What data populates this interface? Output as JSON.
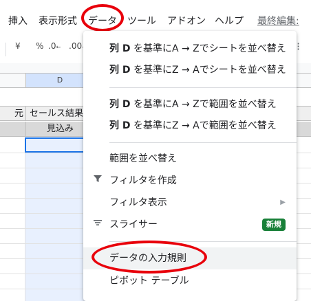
{
  "menubar": {
    "insert": "挿入",
    "format": "表示形式",
    "data": "データ",
    "tools": "ツール",
    "addons": "アドオン",
    "help": "ヘルプ",
    "last_edit": "最終編集:"
  },
  "toolbar": {
    "currency": "¥",
    "percent": "%",
    "decrease_decimal": ".0",
    "increase_decimal": ".00",
    "more": "⁝"
  },
  "grid": {
    "column_header": "D",
    "row1": {
      "partial_left": "元",
      "col_d": "セールス結果"
    },
    "row2": {
      "col_d": "見込み"
    }
  },
  "dropdown": {
    "items": [
      {
        "label_prefix": "列 D",
        "label_rest": " を基準にA → Zでシートを並べ替え"
      },
      {
        "label_prefix": "列 D",
        "label_rest": " を基準にZ → Aでシートを並べ替え"
      },
      {
        "label_prefix": "列 D",
        "label_rest": " を基準にA → Zで範囲を並べ替え"
      },
      {
        "label_prefix": "列 D",
        "label_rest": " を基準にZ → Aで範囲を並べ替え"
      },
      {
        "label": "範囲を並べ替え"
      },
      {
        "label": "フィルタを作成",
        "icon": "filter-icon"
      },
      {
        "label": "フィルタ表示",
        "arrow": "▶"
      },
      {
        "label": "スライサー",
        "icon": "slicer-icon",
        "badge": "新規"
      },
      {
        "label": "データの入力規則"
      },
      {
        "label": "ピボット テーブル"
      }
    ]
  },
  "colors": {
    "highlight_circle": "#e8000b",
    "selection": "#1a73e8",
    "badge": "#188038",
    "column_fill": "#e8f0fe"
  }
}
